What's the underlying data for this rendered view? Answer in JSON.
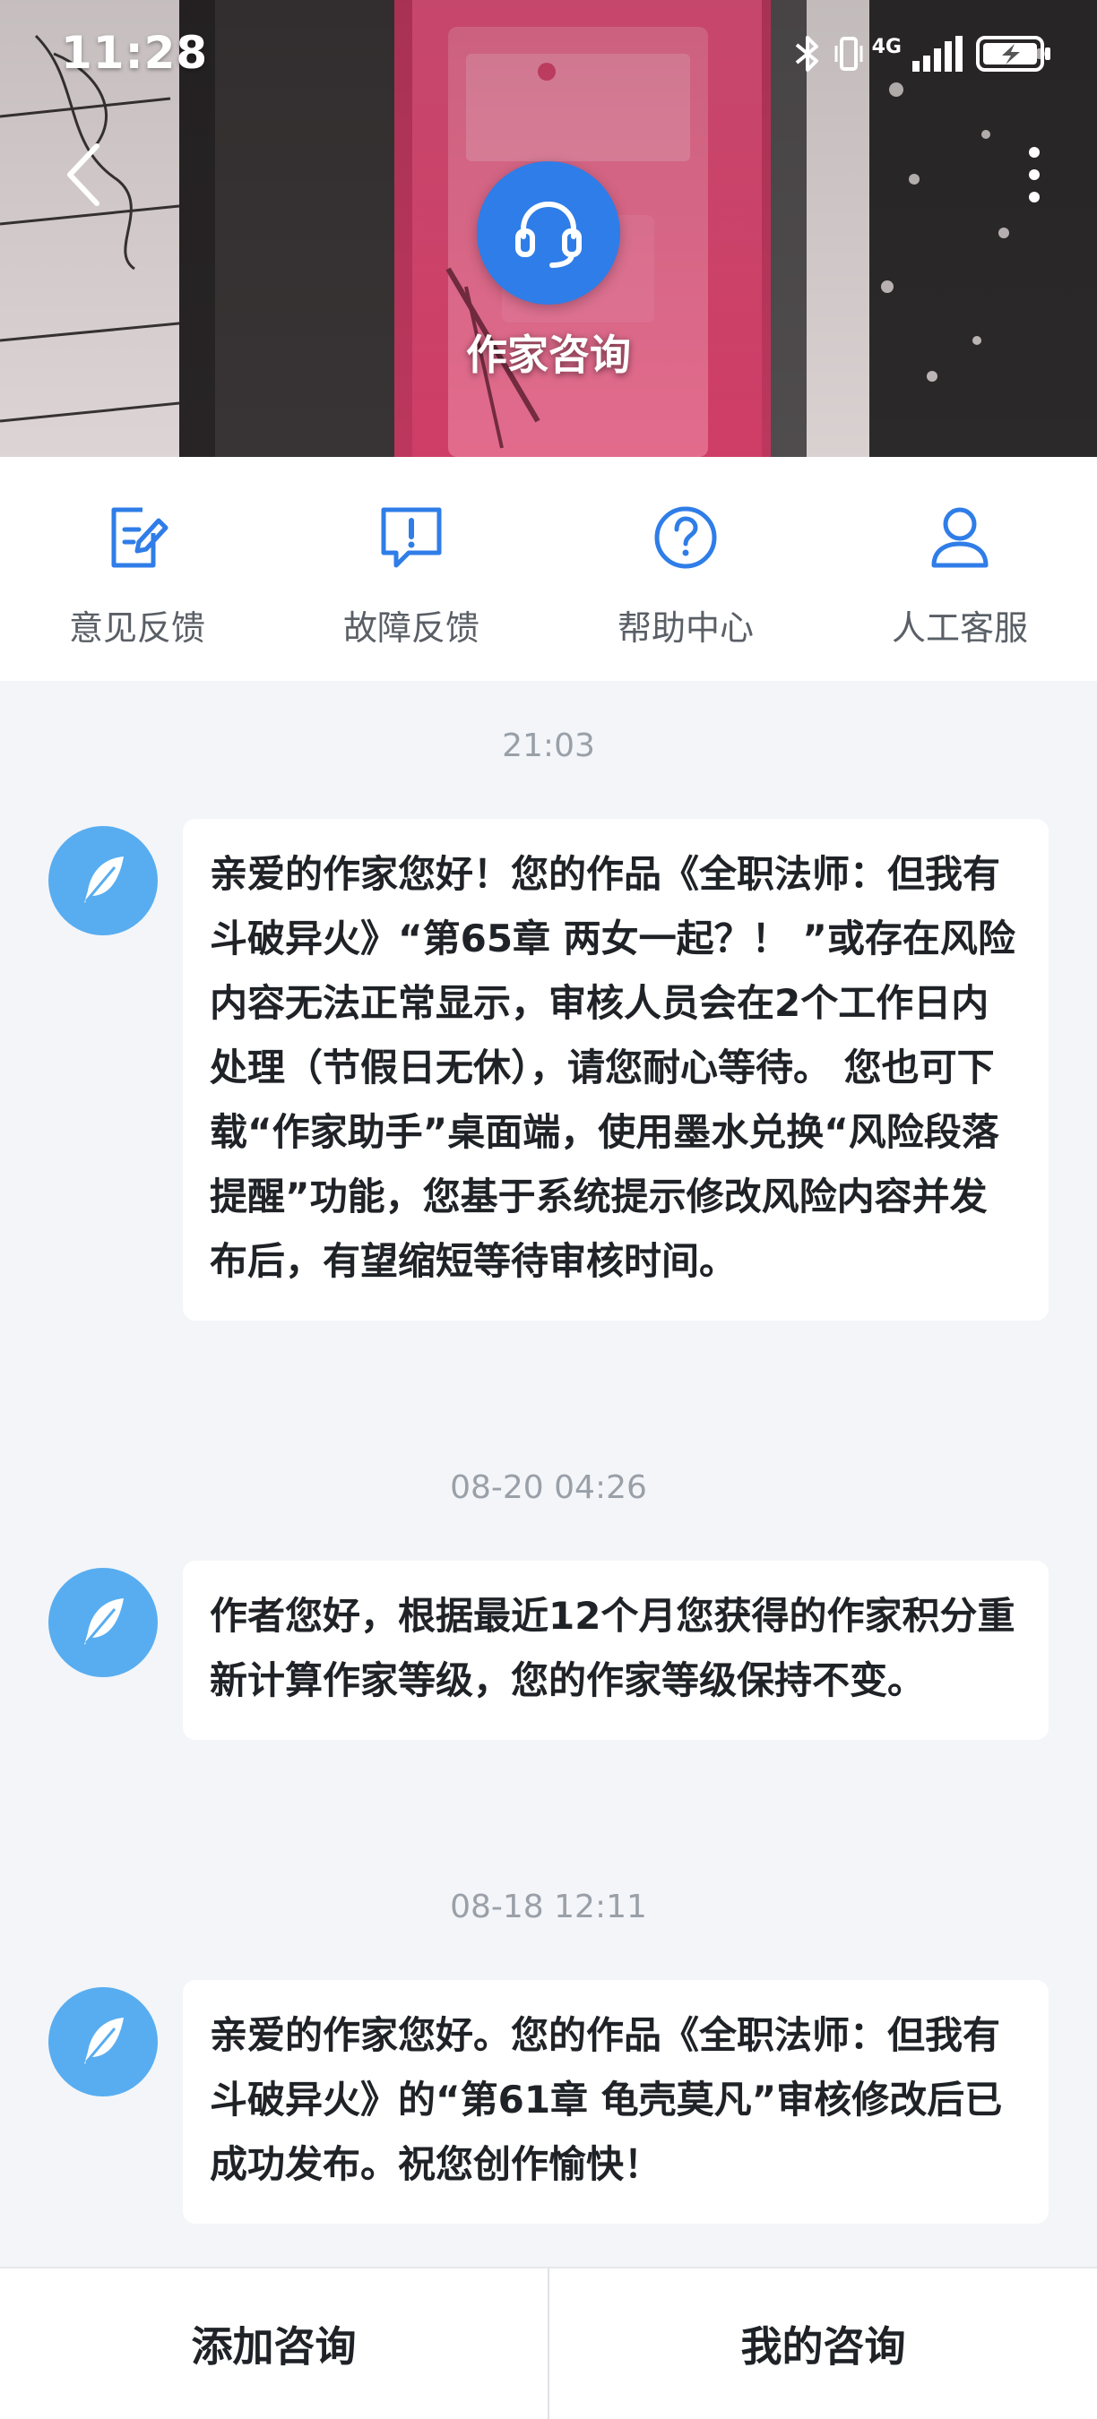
{
  "status_bar": {
    "time": "11:28",
    "network_label": "4G",
    "icons": [
      "bluetooth-icon",
      "vibrate-icon",
      "signal-icon",
      "battery-charging-icon"
    ]
  },
  "header": {
    "title": "作家咨询",
    "logo_icon": "headset-icon",
    "back_icon": "chevron-left-icon",
    "more_icon": "more-vertical-icon"
  },
  "quick_nav": [
    {
      "label": "意见反馈",
      "icon": "feedback-edit-icon"
    },
    {
      "label": "故障反馈",
      "icon": "report-issue-icon"
    },
    {
      "label": "帮助中心",
      "icon": "help-circle-icon"
    },
    {
      "label": "人工客服",
      "icon": "person-icon"
    }
  ],
  "messages": [
    {
      "time": "21:03",
      "avatar_icon": "feather-icon",
      "text": "亲爱的作家您好！您的作品《全职法师：但我有斗破异火》“第65章 两女一起？！ ”或存在风险内容无法正常显示，审核人员会在2个工作日内处理（节假日无休），请您耐心等待。 您也可下载“作家助手”桌面端，使用墨水兑换“风险段落提醒”功能，您基于系统提示修改风险内容并发布后，有望缩短等待审核时间。"
    },
    {
      "time": "08-20 04:26",
      "avatar_icon": "feather-icon",
      "text": "作者您好，根据最近12个月您获得的作家积分重新计算作家等级，您的作家等级保持不变。"
    },
    {
      "time": "08-18 12:11",
      "avatar_icon": "feather-icon",
      "text": "亲爱的作家您好。您的作品《全职法师：但我有斗破异火》的“第61章 龟壳莫凡”审核修改后已成功发布。祝您创作愉快！"
    }
  ],
  "bottom_bar": {
    "add_label": "添加咨询",
    "mine_label": "我的咨询"
  },
  "colors": {
    "accent": "#2f7de8",
    "avatar": "#58adf0",
    "icon_blue": "#2f7de8",
    "background": "#f3f5f9"
  }
}
